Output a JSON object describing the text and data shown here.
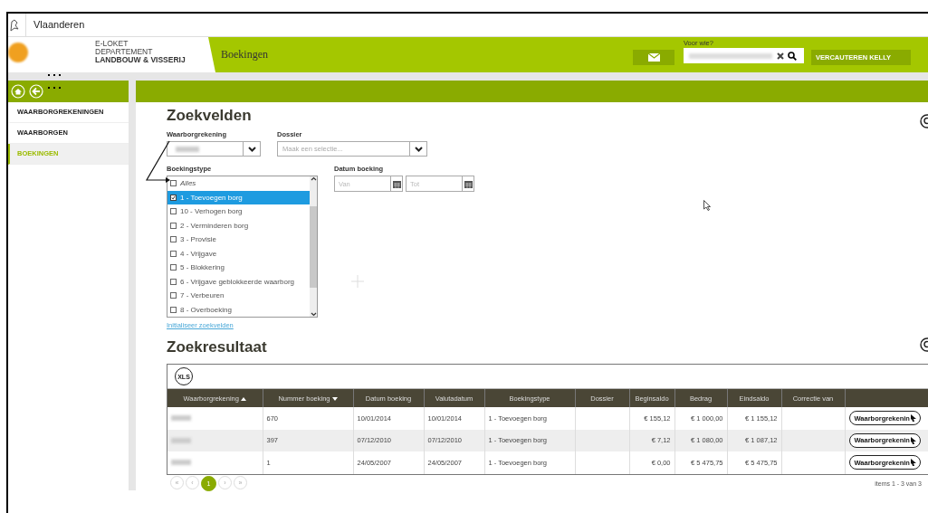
{
  "brand": {
    "title": "Vlaanderen"
  },
  "header": {
    "logo_lines": [
      "E-LOKET",
      "DEPARTEMENT",
      "LANDBOUW & VISSERIJ"
    ],
    "page_title": "Boekingen",
    "for_whom_label": "Voor wie?",
    "user": "VERCAUTEREN KELLY"
  },
  "sidebar": {
    "items": [
      {
        "label": "WAARBORGREKENINGEN",
        "selected": false
      },
      {
        "label": "WAARBORGEN",
        "selected": false
      },
      {
        "label": "BOEKINGEN",
        "selected": true
      }
    ]
  },
  "search": {
    "title": "Zoekvelden",
    "account": {
      "label": "Waarborgrekening"
    },
    "dossier": {
      "label": "Dossier",
      "placeholder": "Maak een selectie..."
    },
    "booking_type": {
      "label": "Boekingstype",
      "options": [
        {
          "kind": "all",
          "label": "Alles",
          "checked": false,
          "selected": false
        },
        {
          "kind": "type",
          "label": "1 - Toevoegen borg",
          "checked": true,
          "selected": true
        },
        {
          "kind": "type",
          "label": "10 - Verhogen borg",
          "checked": false,
          "selected": false
        },
        {
          "kind": "type",
          "label": "2 - Verminderen borg",
          "checked": false,
          "selected": false
        },
        {
          "kind": "type",
          "label": "3 - Provisie",
          "checked": false,
          "selected": false
        },
        {
          "kind": "type",
          "label": "4 - Vrijgave",
          "checked": false,
          "selected": false
        },
        {
          "kind": "type",
          "label": "5 - Blokkering",
          "checked": false,
          "selected": false
        },
        {
          "kind": "type",
          "label": "6 - Vrijgave geblokkeerde waarborg",
          "checked": false,
          "selected": false
        },
        {
          "kind": "type",
          "label": "7 - Verbeuren",
          "checked": false,
          "selected": false
        },
        {
          "kind": "type",
          "label": "8 - Overboeking",
          "checked": false,
          "selected": false
        }
      ]
    },
    "date": {
      "label": "Datum boeking",
      "from_placeholder": "Van",
      "to_placeholder": "Tot"
    },
    "reset_link": "Initialiseer zoekvelden"
  },
  "results": {
    "title": "Zoekresultaat",
    "export": "XLS",
    "columns": [
      {
        "label": "Waarborgrekening",
        "sorted_ascending": true,
        "sorted_descending": false
      },
      {
        "label": "Nummer boeking",
        "sorted_ascending": false,
        "sorted_descending": true
      },
      {
        "label": "Datum boeking",
        "sorted_ascending": false,
        "sorted_descending": false
      },
      {
        "label": "Valutadatum",
        "sorted_ascending": false,
        "sorted_descending": false
      },
      {
        "label": "Boekingstype",
        "sorted_ascending": false,
        "sorted_descending": false
      },
      {
        "label": "Dossier",
        "sorted_ascending": false,
        "sorted_descending": false
      },
      {
        "label": "Beginsaldo",
        "sorted_ascending": false,
        "sorted_descending": false
      },
      {
        "label": "Bedrag",
        "sorted_ascending": false,
        "sorted_descending": false
      },
      {
        "label": "Eindsaldo",
        "sorted_ascending": false,
        "sorted_descending": false
      },
      {
        "label": "Correctie van",
        "sorted_ascending": false,
        "sorted_descending": false
      }
    ],
    "rows": [
      {
        "number": "670",
        "booking_date": "10/01/2014",
        "value_date": "10/01/2014",
        "type": "1 - Toevoegen borg",
        "begin": "€ 155,12",
        "amount": "€ 1 000,00",
        "end": "€ 1 155,12",
        "action": "Waarborgrekenin"
      },
      {
        "number": "397",
        "booking_date": "07/12/2010",
        "value_date": "07/12/2010",
        "type": "1 - Toevoegen borg",
        "begin": "€ 7,12",
        "amount": "€ 1 080,00",
        "end": "€ 1 087,12",
        "action": "Waarborgrekenin"
      },
      {
        "number": "1",
        "booking_date": "24/05/2007",
        "value_date": "24/05/2007",
        "type": "1 - Toevoegen borg",
        "begin": "€ 0,00",
        "amount": "€ 5 475,75",
        "end": "€ 5 475,75",
        "action": "Waarborgrekenin"
      }
    ],
    "pager": {
      "first": "«",
      "prev": "‹",
      "pages": [
        {
          "label": "1",
          "selected": true
        }
      ],
      "next": "›",
      "last": "»"
    },
    "summary": "items 1 - 3 van 3"
  }
}
